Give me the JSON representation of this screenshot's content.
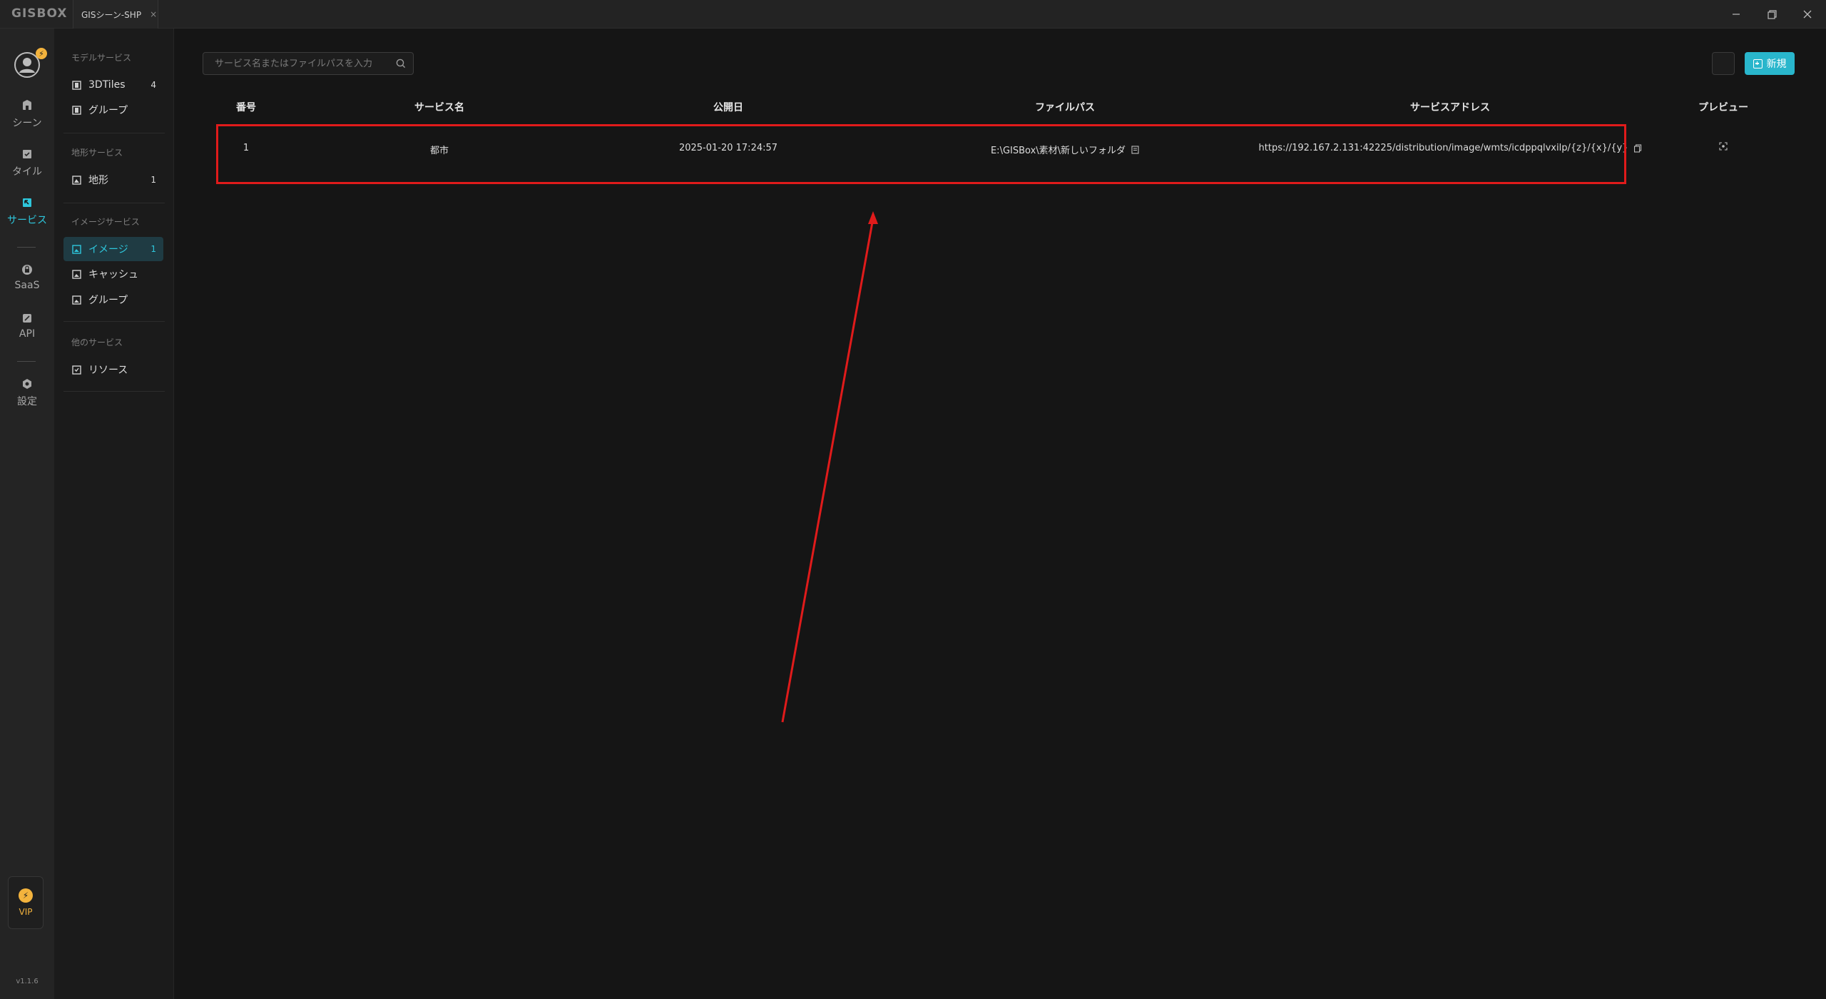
{
  "app": {
    "logo": "GISBOX",
    "tab_title": "GISシーン-SHP",
    "tab_close": "×"
  },
  "rail": {
    "avatar_badge": "⚡",
    "items": [
      {
        "label": "シーン",
        "icon": "scene-icon"
      },
      {
        "label": "タイル",
        "icon": "tile-icon"
      },
      {
        "label": "サービス",
        "icon": "service-icon",
        "active": true
      },
      {
        "label": "SaaS",
        "icon": "saas-icon"
      },
      {
        "label": "API",
        "icon": "api-icon"
      },
      {
        "label": "設定",
        "icon": "settings-icon"
      }
    ],
    "vip_label": "VIP",
    "vip_icon": "⚡",
    "version": "v1.1.6"
  },
  "sidebar": {
    "sections": [
      {
        "title": "モデルサービス",
        "items": [
          {
            "label": "3DTiles",
            "count": "4"
          },
          {
            "label": "グループ",
            "count": ""
          }
        ]
      },
      {
        "title": "地形サービス",
        "items": [
          {
            "label": "地形",
            "count": "1"
          }
        ]
      },
      {
        "title": "イメージサービス",
        "items": [
          {
            "label": "イメージ",
            "count": "1",
            "active": true
          },
          {
            "label": "キャッシュ",
            "count": ""
          },
          {
            "label": "グループ",
            "count": ""
          }
        ]
      },
      {
        "title": "他のサービス",
        "items": [
          {
            "label": "リソース",
            "count": ""
          }
        ]
      }
    ]
  },
  "main": {
    "search_placeholder": "サービス名またはファイルパスを入力",
    "new_button": "新規",
    "columns": [
      "番号",
      "サービス名",
      "公開日",
      "ファイルパス",
      "サービスアドレス",
      "プレビュー"
    ],
    "rows": [
      {
        "no": "1",
        "name": "都市",
        "date": "2025-01-20 17:24:57",
        "path": "E:\\GISBox\\素材\\新しいフォルダ",
        "address": "https://192.167.2.131:42225/distribution/image/wmts/icdppqlvxilp/{z}/{x}/{y}"
      }
    ]
  },
  "colors": {
    "accent": "#2ec6db",
    "highlight": "#e01b1b",
    "vip": "#f3b33d"
  }
}
